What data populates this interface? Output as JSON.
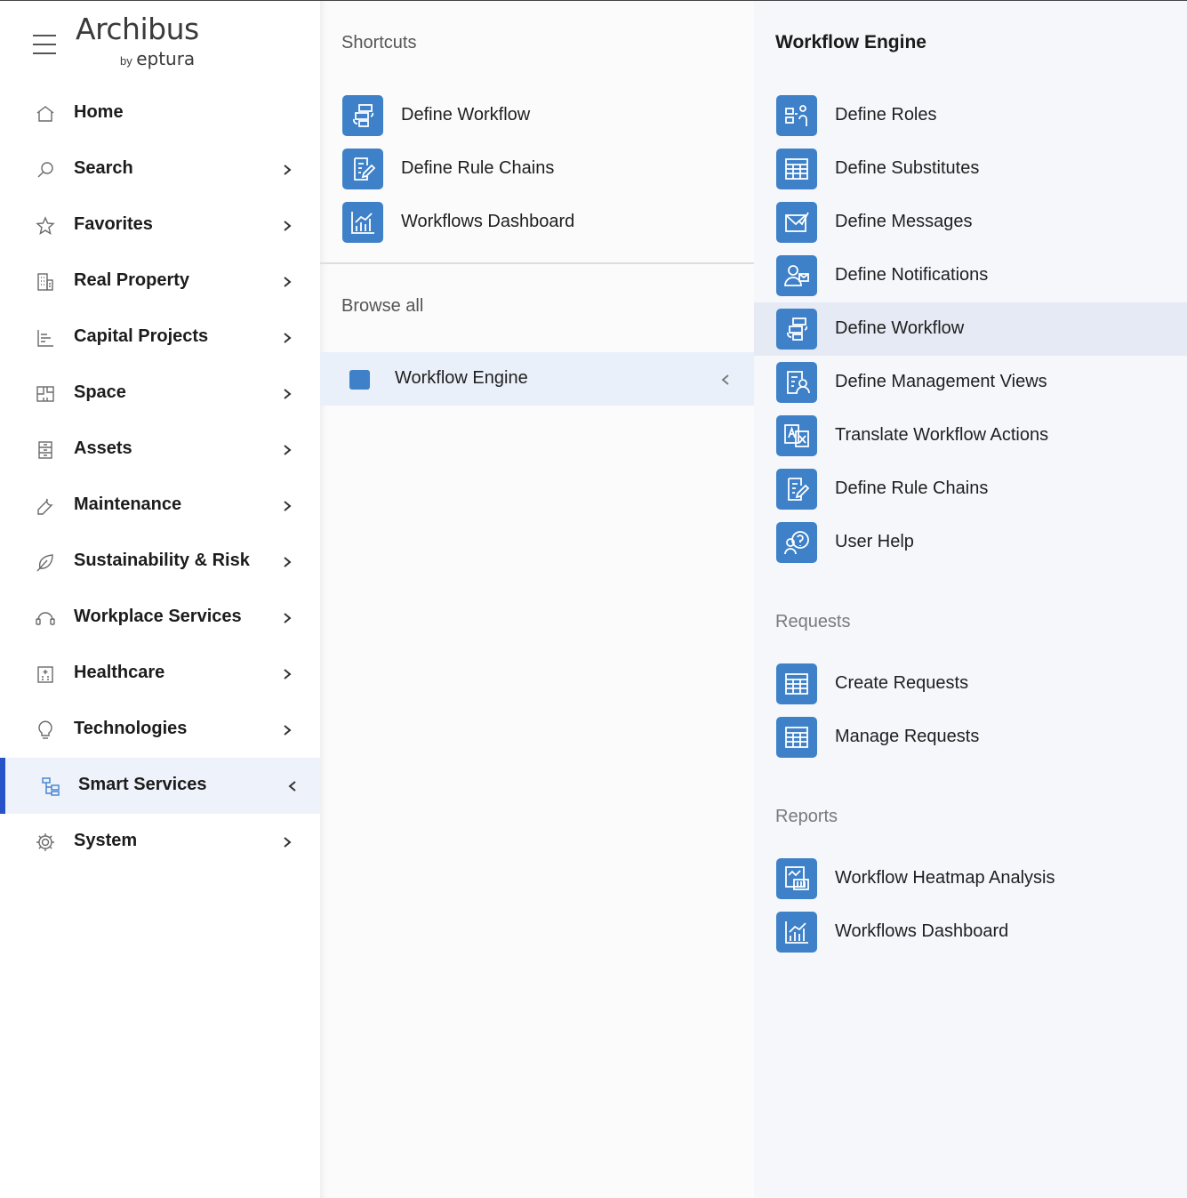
{
  "app": {
    "logo_main": "Archibus",
    "logo_by": "by",
    "logo_brand": "eptura"
  },
  "nav": {
    "items": [
      {
        "label": "Home",
        "icon": "home-icon"
      },
      {
        "label": "Search",
        "icon": "search-icon"
      },
      {
        "label": "Favorites",
        "icon": "star-icon"
      },
      {
        "label": "Real Property",
        "icon": "building-icon"
      },
      {
        "label": "Capital Projects",
        "icon": "bar-chart-icon"
      },
      {
        "label": "Space",
        "icon": "floorplan-icon"
      },
      {
        "label": "Assets",
        "icon": "cabinet-icon"
      },
      {
        "label": "Maintenance",
        "icon": "wrench-icon"
      },
      {
        "label": "Sustainability & Risk",
        "icon": "leaf-icon"
      },
      {
        "label": "Workplace Services",
        "icon": "headset-icon"
      },
      {
        "label": "Healthcare",
        "icon": "hospital-icon"
      },
      {
        "label": "Technologies",
        "icon": "lightbulb-icon"
      },
      {
        "label": "Smart Services",
        "icon": "hierarchy-icon"
      },
      {
        "label": "System",
        "icon": "gear-icon"
      }
    ],
    "active": "Smart Services"
  },
  "middle": {
    "shortcuts_title": "Shortcuts",
    "shortcuts": [
      {
        "label": "Define Workflow",
        "icon": "workflow-icon"
      },
      {
        "label": "Define Rule Chains",
        "icon": "edit-document-icon"
      },
      {
        "label": "Workflows Dashboard",
        "icon": "dashboard-chart-icon"
      }
    ],
    "browse_title": "Browse all",
    "browse_item": "Workflow Engine"
  },
  "right": {
    "title": "Workflow Engine",
    "items": [
      {
        "label": "Define Roles",
        "icon": "roles-icon"
      },
      {
        "label": "Define Substitutes",
        "icon": "grid-table-icon"
      },
      {
        "label": "Define Messages",
        "icon": "message-check-icon"
      },
      {
        "label": "Define Notifications",
        "icon": "notification-user-icon"
      },
      {
        "label": "Define Workflow",
        "icon": "workflow-icon"
      },
      {
        "label": "Define Management Views",
        "icon": "management-view-icon"
      },
      {
        "label": "Translate Workflow Actions",
        "icon": "translate-icon"
      },
      {
        "label": "Define Rule Chains",
        "icon": "edit-document-icon"
      },
      {
        "label": "User Help",
        "icon": "help-icon"
      }
    ],
    "highlighted": "Define Workflow",
    "requests_title": "Requests",
    "requests": [
      {
        "label": "Create Requests",
        "icon": "grid-table-icon"
      },
      {
        "label": "Manage Requests",
        "icon": "grid-table-icon"
      }
    ],
    "reports_title": "Reports",
    "reports": [
      {
        "label": "Workflow Heatmap Analysis",
        "icon": "heatmap-icon"
      },
      {
        "label": "Workflows Dashboard",
        "icon": "dashboard-chart-icon"
      }
    ]
  },
  "colors": {
    "accent": "#3e81c8",
    "active_bar": "#2752c8",
    "highlight_row": "#e5eaf4"
  }
}
